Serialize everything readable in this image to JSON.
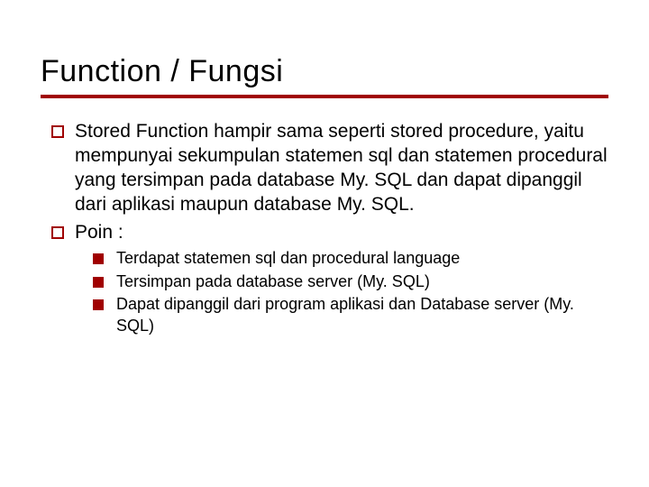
{
  "title": "Function / Fungsi",
  "bullets": [
    {
      "text": "Stored Function hampir sama seperti stored procedure, yaitu mempunyai sekumpulan statemen sql dan statemen procedural yang tersimpan pada database My. SQL dan dapat dipanggil dari aplikasi maupun database My. SQL."
    },
    {
      "text": "Poin :",
      "children": [
        "Terdapat statemen sql dan procedural language",
        "Tersimpan pada database server (My. SQL)",
        "Dapat dipanggil dari program aplikasi dan Database server (My. SQL)"
      ]
    }
  ]
}
